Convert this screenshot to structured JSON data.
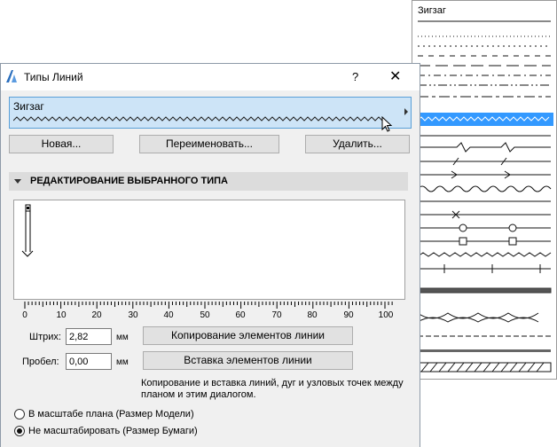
{
  "dialog": {
    "title": "Типы Линий",
    "help": "?",
    "close": "✕"
  },
  "selected_type": {
    "name": "Зигзаг"
  },
  "buttons": {
    "new": "Новая...",
    "rename": "Переименовать...",
    "delete": "Удалить..."
  },
  "section": {
    "title": "РЕДАКТИРОВАНИЕ ВЫБРАННОГО ТИПА"
  },
  "ruler": {
    "ticks": [
      "0",
      "10",
      "20",
      "30",
      "40",
      "50",
      "60",
      "70",
      "80",
      "90",
      "100"
    ]
  },
  "dash": {
    "label": "Штрих:",
    "value": "2,82",
    "unit": "мм"
  },
  "gap": {
    "label": "Пробел:",
    "value": "0,00",
    "unit": "мм"
  },
  "copy_button": "Копирование элементов линии",
  "paste_button": "Вставка элементов линии",
  "note": "Копирование и вставка линий, дуг и узловых точек между планом и этим диалогом.",
  "scale_options": [
    {
      "label": "В масштабе плана (Размер Модели)",
      "selected": false
    },
    {
      "label": "Не масштабировать (Размер Бумаги)",
      "selected": true
    }
  ],
  "dropdown": {
    "header": "Зигзаг",
    "items": [
      "solid",
      "dotted-fine",
      "dotted",
      "dashed-short",
      "dashed-long",
      "dash-dot",
      "dash-dot-dot",
      "dash-dash",
      "zigzag",
      "solid-2",
      "zigzag-break",
      "break-slash",
      "arrow-line",
      "wave",
      "cross-dash",
      "x-mark",
      "circle-line",
      "square-line",
      "zigzag-small",
      "plus-line",
      "hatched-band",
      "scallop-down",
      "scallop-up",
      "tick-line",
      "stripe-band",
      "hatch-diagonal"
    ],
    "highlight_color": "#3399ff"
  }
}
